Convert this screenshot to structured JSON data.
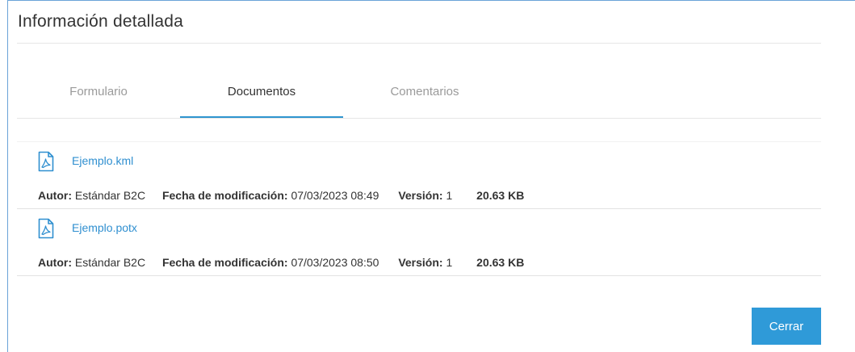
{
  "dialog": {
    "title": "Información detallada"
  },
  "tabs": [
    {
      "label": "Formulario",
      "active": false
    },
    {
      "label": "Documentos",
      "active": true
    },
    {
      "label": "Comentarios",
      "active": false
    }
  ],
  "documents": [
    {
      "icon": "pdf-file-icon",
      "name": "Ejemplo.kml",
      "author_label": "Autor:",
      "author": "Estándar B2C",
      "modified_label": "Fecha de modificación:",
      "modified": "07/03/2023 08:49",
      "version_label": "Versión:",
      "version": "1",
      "size": "20.63 KB"
    },
    {
      "icon": "pdf-file-icon",
      "name": "Ejemplo.potx",
      "author_label": "Autor:",
      "author": "Estándar B2C",
      "modified_label": "Fecha de modificación:",
      "modified": "07/03/2023 08:50",
      "version_label": "Versión:",
      "version": "1",
      "size": "20.63 KB"
    }
  ],
  "footer": {
    "close_label": "Cerrar"
  },
  "colors": {
    "accent": "#2f9ad8",
    "link": "#2f8fd0",
    "border": "#6aa3d8"
  }
}
